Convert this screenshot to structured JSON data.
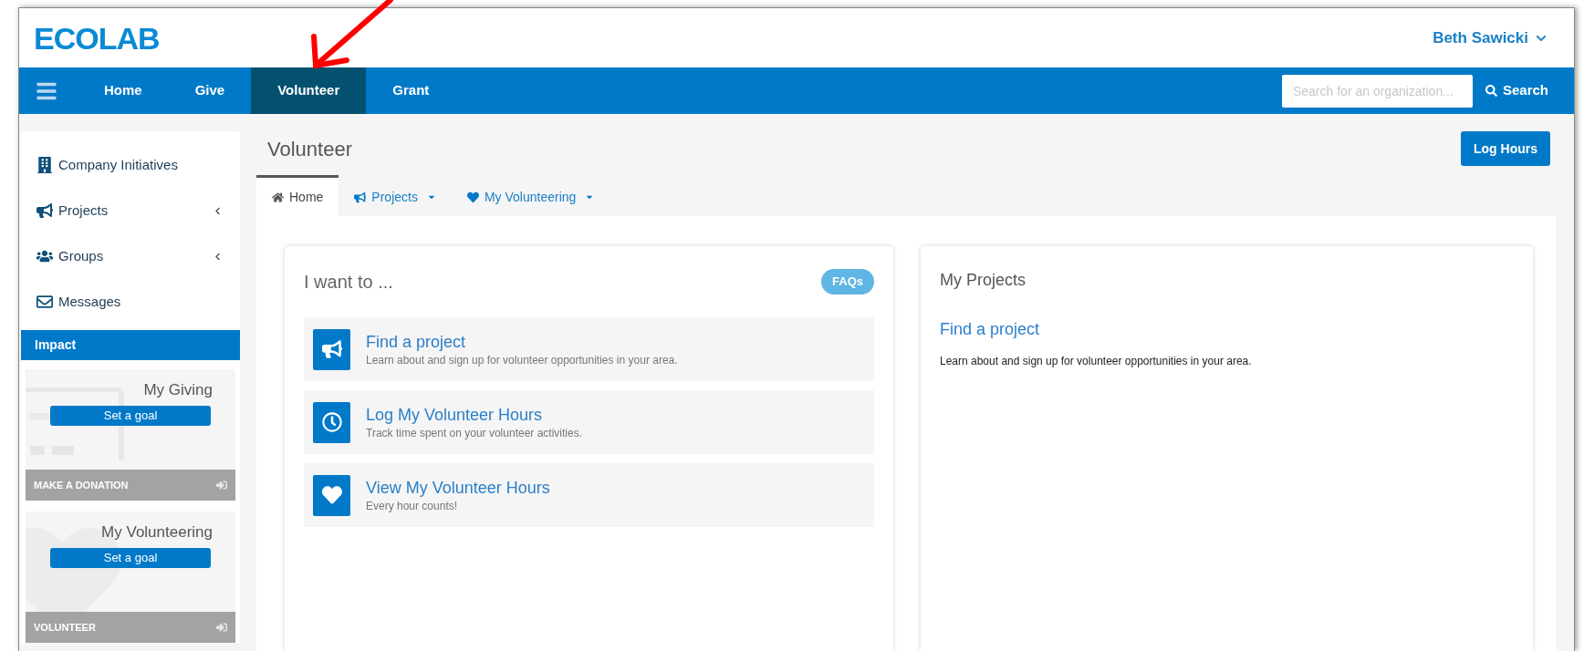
{
  "header": {
    "logo": "ECOLAB",
    "user": "Beth Sawicki"
  },
  "nav": {
    "items": [
      {
        "label": "Home",
        "selected": false
      },
      {
        "label": "Give",
        "selected": false
      },
      {
        "label": "Volunteer",
        "selected": true
      },
      {
        "label": "Grant",
        "selected": false
      }
    ],
    "search": {
      "placeholder": "Search for an organization...",
      "button": "Search"
    }
  },
  "sidebar": {
    "items": [
      {
        "label": "Company Initiatives",
        "collapsible": false
      },
      {
        "label": "Projects",
        "collapsible": true
      },
      {
        "label": "Groups",
        "collapsible": true
      },
      {
        "label": "Messages",
        "collapsible": false
      }
    ],
    "impact": {
      "title": "Impact",
      "cards": [
        {
          "title": "My Giving",
          "button": "Set a goal",
          "footer": "MAKE A DONATION"
        },
        {
          "title": "My Volunteering",
          "button": "Set a goal",
          "footer": "VOLUNTEER"
        }
      ]
    }
  },
  "page": {
    "title": "Volunteer",
    "action": "Log Hours",
    "tabs": [
      {
        "label": "Home",
        "selected": true,
        "dropdown": false
      },
      {
        "label": "Projects",
        "selected": false,
        "dropdown": true
      },
      {
        "label": "My Volunteering",
        "selected": false,
        "dropdown": true
      }
    ]
  },
  "actions_card": {
    "title": "I want to ...",
    "faqs": "FAQs",
    "items": [
      {
        "title": "Find a project",
        "description": "Learn about and sign up for volunteer opportunities in your area."
      },
      {
        "title": "Log My Volunteer Hours",
        "description": "Track time spent on your volunteer activities."
      },
      {
        "title": "View My Volunteer Hours",
        "description": "Every hour counts!"
      }
    ]
  },
  "projects_card": {
    "title": "My Projects",
    "link": "Find a project",
    "description": "Learn about and sign up for volunteer opportunities in your area."
  }
}
